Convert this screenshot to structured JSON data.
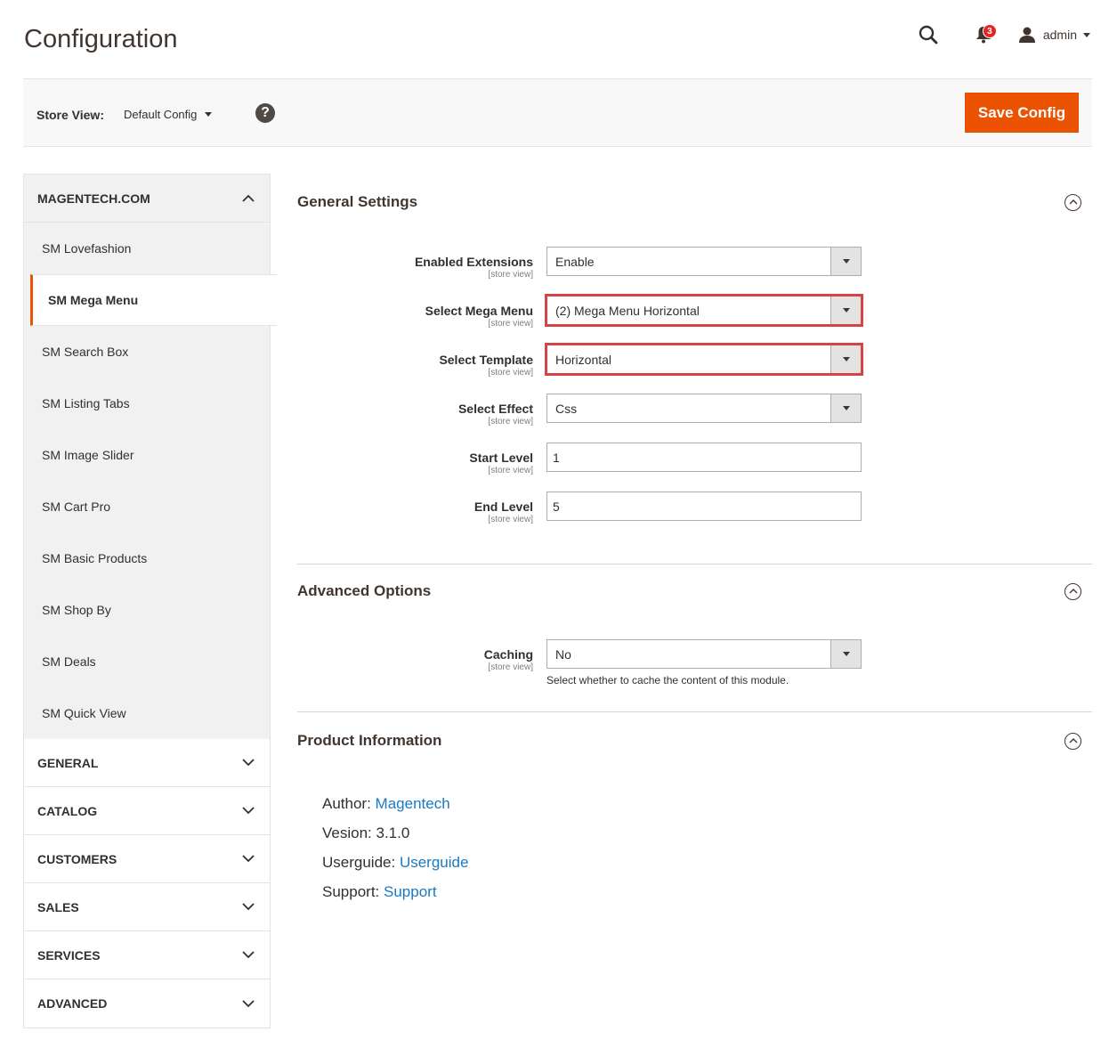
{
  "page": {
    "title": "Configuration"
  },
  "header": {
    "notification_count": "3",
    "user_name": "admin"
  },
  "toolbar": {
    "store_view_label": "Store View:",
    "store_view_value": "Default Config",
    "help_glyph": "?",
    "save_label": "Save Config"
  },
  "sidebar": {
    "active_group": {
      "title": "MAGENTECH.COM",
      "items": [
        {
          "label": "SM Lovefashion"
        },
        {
          "label": "SM Mega Menu"
        },
        {
          "label": "SM Search Box"
        },
        {
          "label": "SM Listing Tabs"
        },
        {
          "label": "SM Image Slider"
        },
        {
          "label": "SM Cart Pro"
        },
        {
          "label": "SM Basic Products"
        },
        {
          "label": "SM Shop By"
        },
        {
          "label": "SM Deals"
        },
        {
          "label": "SM Quick View"
        }
      ],
      "active_item": "SM Mega Menu"
    },
    "groups": [
      {
        "title": "GENERAL"
      },
      {
        "title": "CATALOG"
      },
      {
        "title": "CUSTOMERS"
      },
      {
        "title": "SALES"
      },
      {
        "title": "SERVICES"
      },
      {
        "title": "ADVANCED"
      }
    ]
  },
  "general_settings": {
    "title": "General Settings",
    "fields": [
      {
        "label": "Enabled Extensions",
        "scope": "[store view]",
        "value": "Enable"
      },
      {
        "label": "Select Mega Menu",
        "scope": "[store view]",
        "value": "(2) Mega Menu Horizontal"
      },
      {
        "label": "Select Template",
        "scope": "[store view]",
        "value": "Horizontal"
      },
      {
        "label": "Select Effect",
        "scope": "[store view]",
        "value": "Css"
      },
      {
        "label": "Start Level",
        "scope": "[store view]",
        "value": "1"
      },
      {
        "label": "End Level",
        "scope": "[store view]",
        "value": "5"
      }
    ]
  },
  "advanced_options": {
    "title": "Advanced Options",
    "caching": {
      "label": "Caching",
      "scope": "[store view]",
      "value": "No",
      "note": "Select whether to cache the content of this module."
    }
  },
  "product_information": {
    "title": "Product Information",
    "author_label": "Author:",
    "author_value": "Magentech",
    "version_label": "Vesion:",
    "version_value": "3.1.0",
    "userguide_label": "Userguide:",
    "userguide_value": "Userguide",
    "support_label": "Support:",
    "support_value": "Support"
  },
  "colors": {
    "accent": "#eb5202",
    "link": "#1979c3",
    "highlight": "#d64545"
  }
}
